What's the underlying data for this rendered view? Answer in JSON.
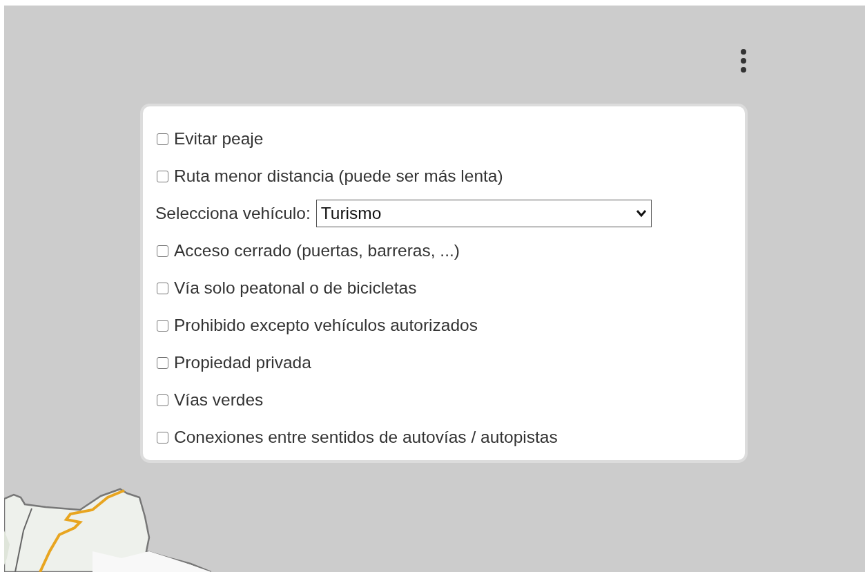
{
  "options": [
    {
      "kind": "checkbox",
      "label": "Evitar peaje",
      "checked": false
    },
    {
      "kind": "checkbox",
      "label": "Ruta menor distancia (puede ser más lenta)",
      "checked": false
    },
    {
      "kind": "select",
      "label": "Selecciona vehículo:",
      "value": "Turismo"
    },
    {
      "kind": "checkbox",
      "label": "Acceso cerrado (puertas, barreras, ...)",
      "checked": false
    },
    {
      "kind": "checkbox",
      "label": "Vía solo peatonal o de bicicletas",
      "checked": false
    },
    {
      "kind": "checkbox",
      "label": "Prohibido excepto vehículos autorizados",
      "checked": false
    },
    {
      "kind": "checkbox",
      "label": "Propiedad privada",
      "checked": false
    },
    {
      "kind": "checkbox",
      "label": "Vías verdes",
      "checked": false
    },
    {
      "kind": "checkbox",
      "label": "Conexiones entre sentidos de autovías / autopistas",
      "checked": false
    }
  ]
}
